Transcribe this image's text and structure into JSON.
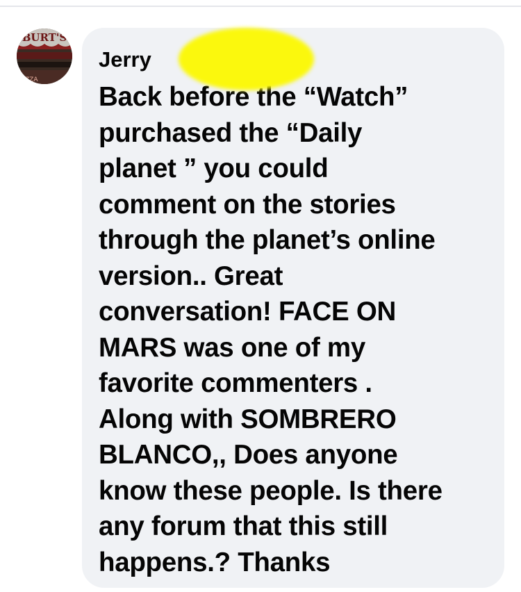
{
  "comment": {
    "author": "Jerry",
    "avatar_sign_text": "BURT'S",
    "avatar_sub_text": "ZZA",
    "text": "Back before the “Watch”\npurchased the “Daily\nplanet ” you could\ncomment on the stories\nthrough the planet’s online\nversion..  Great\nconversation!  FACE ON\nMARS was one of my\nfavorite commenters .\nAlong with SOMBRERO\nBLANCO,,   Does anyone\nknow these people. Is there\nany forum that this still\nhappens.? Thanks"
  },
  "colors": {
    "bubble_background": "#f0f2f5",
    "text": "#050505",
    "redaction_highlight": "#fbf80d"
  }
}
